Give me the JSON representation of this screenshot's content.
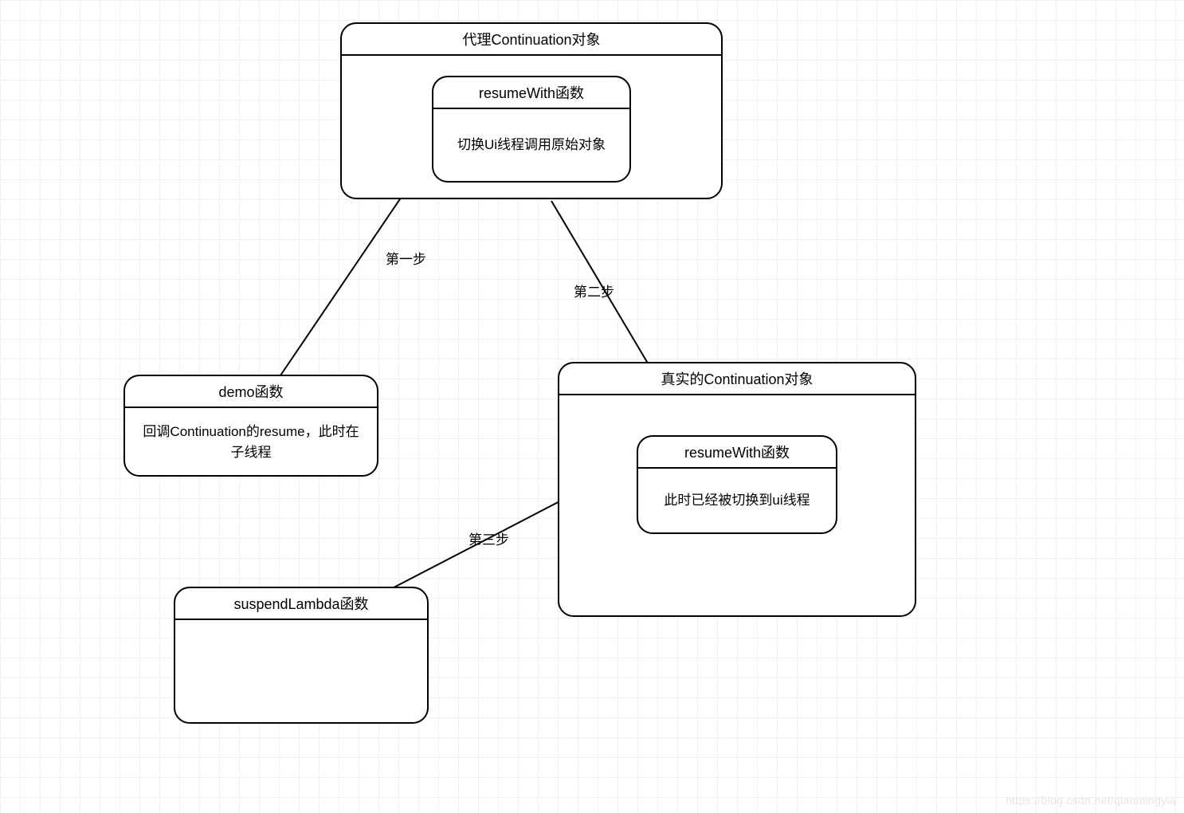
{
  "nodes": {
    "proxy": {
      "title": "代理Continuation对象",
      "inner": {
        "title": "resumeWith函数",
        "body": "切换Ui线程调用原始对象"
      }
    },
    "demo": {
      "title": "demo函数",
      "body": "回调Continuation的resume，此时在子线程"
    },
    "real": {
      "title": "真实的Continuation对象",
      "inner": {
        "title": "resumeWith函数",
        "body": "此时已经被切换到ui线程"
      }
    },
    "suspend": {
      "title": "suspendLambda函数",
      "body": ""
    }
  },
  "edges": {
    "step1": "第一步",
    "step2": "第二步",
    "step3": "第三步"
  },
  "watermark": "https://blog.csdn.net/qlanmingyia"
}
